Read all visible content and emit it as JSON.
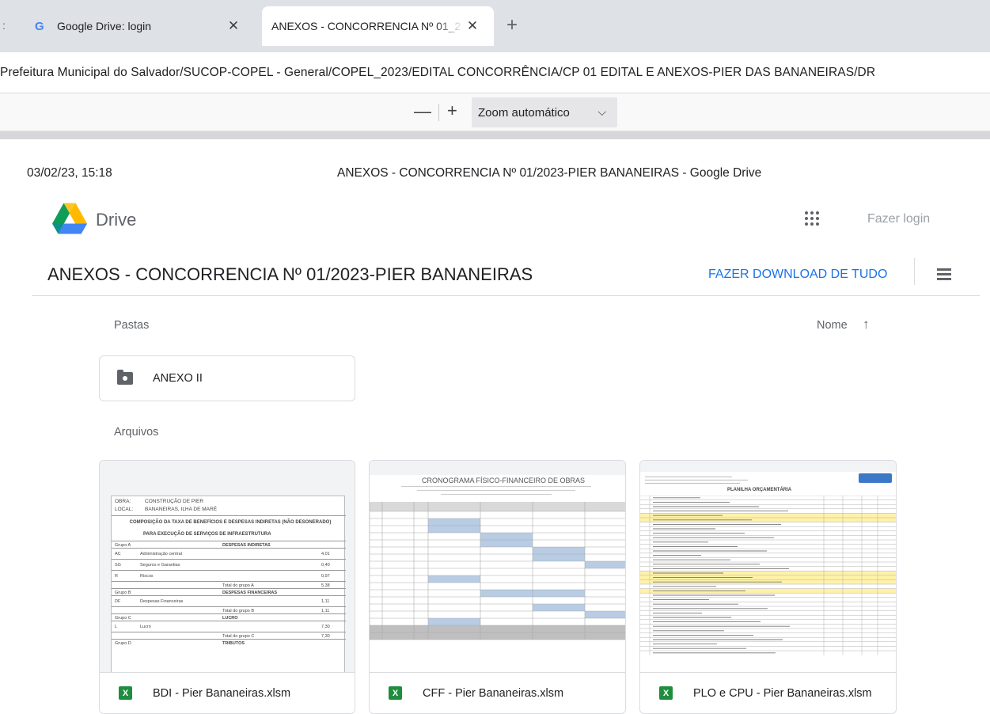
{
  "browser": {
    "tabs": [
      {
        "label": "Google Drive: login",
        "active": false,
        "favicon": "google-g-icon"
      },
      {
        "label": "ANEXOS - CONCORRENCIA Nº 01_2",
        "active": true,
        "favicon": ""
      }
    ],
    "address": "Prefeitura Municipal do Salvador/SUCOP-COPEL - General/COPEL_2023/EDITAL CONCORRÊNCIA/CP 01 EDITAL E ANEXOS-PIER DAS BANANEIRAS/DR"
  },
  "pdf_toolbar": {
    "zoom_out": "—",
    "zoom_in": "+",
    "zoom_label": "Zoom automático"
  },
  "printout": {
    "date": "03/02/23, 15:18",
    "header_title": "ANEXOS - CONCORRENCIA Nº 01/2023-PIER BANANEIRAS - Google Drive"
  },
  "drive": {
    "brand": "Drive",
    "login": "Fazer login",
    "folder_title": "ANEXOS - CONCORRENCIA Nº 01/2023-PIER BANANEIRAS",
    "download_all": "FAZER DOWNLOAD DE TUDO",
    "folders_label": "Pastas",
    "files_label": "Arquivos",
    "sort_label": "Nome",
    "folders": [
      {
        "name": "ANEXO II"
      }
    ],
    "files": [
      {
        "name": "BDI - Pier Bananeiras.xlsm"
      },
      {
        "name": "CFF - Pier Bananeiras.xlsm"
      },
      {
        "name": "PLO e CPU - Pier Bananeiras.xlsm"
      }
    ]
  },
  "thumbnails": {
    "bdi": {
      "obra_label": "OBRA:",
      "obra_value": "CONSTRUÇÃO DE PIER",
      "local_label": "LOCAL:",
      "local_value": "BANANEIRAS, ILHA DE MARÉ",
      "heading": "COMPOSIÇÃO DA TAXA DE BENEFÍCIOS E DESPESAS INDIRETAS (NÃO DESONERADO)",
      "subheading": "PARA EXECUÇÃO DE SERVIÇOS DE INFRAESTRUTURA",
      "rows": [
        {
          "code": "Grupo A",
          "desc": "DESPESAS INDIRETAS",
          "val": ""
        },
        {
          "code": "AC",
          "desc": "Administração central",
          "val": "4,01"
        },
        {
          "code": "SG",
          "desc": "Seguros e Garantias",
          "val": "0,40"
        },
        {
          "code": "R",
          "desc": "Riscos",
          "val": "0,97"
        },
        {
          "code": "",
          "desc": "Total do grupo A",
          "val": "5,38"
        },
        {
          "code": "Grupo B",
          "desc": "DESPESAS FINANCEIRAS",
          "val": ""
        },
        {
          "code": "DF",
          "desc": "Despesas Financeiras",
          "val": "1,11"
        },
        {
          "code": "",
          "desc": "Total do grupo B",
          "val": "1,11"
        },
        {
          "code": "Grupo C",
          "desc": "LUCRO",
          "val": ""
        },
        {
          "code": "L",
          "desc": "Lucro",
          "val": "7,30"
        },
        {
          "code": "",
          "desc": "Total do grupo C",
          "val": "7,30"
        },
        {
          "code": "Grupo D",
          "desc": "TRIBUTOS",
          "val": ""
        }
      ]
    },
    "cff": {
      "heading": "CRONOGRAMA FÍSICO-FINANCEIRO DE OBRAS"
    },
    "plo": {
      "heading": "PLANILHA ORÇAMENTÁRIA"
    }
  }
}
